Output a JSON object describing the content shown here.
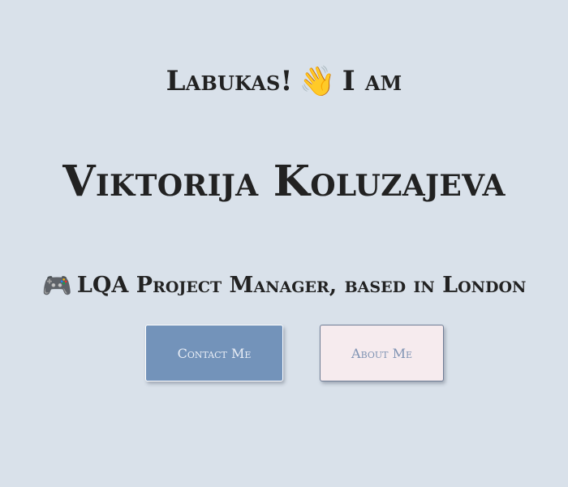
{
  "hero": {
    "greeting_prefix": "Labukas!",
    "greeting_icon": "👋",
    "greeting_suffix": "I am",
    "name": "Viktorija Koluzajeva",
    "role_icon": "🎮",
    "role": "LQA Project Manager, based in London"
  },
  "buttons": {
    "contact_label": "Contact Me",
    "about_label": "About Me"
  },
  "colors": {
    "background": "#d9e1ea",
    "text": "#222222",
    "contact_button_bg": "#7393ba",
    "contact_button_text": "#e9eef6",
    "about_button_bg": "#f6ebee",
    "about_button_text": "#7f93b3"
  },
  "icons": {
    "greeting": "waving-hand-icon",
    "role": "game-controller-icon"
  }
}
